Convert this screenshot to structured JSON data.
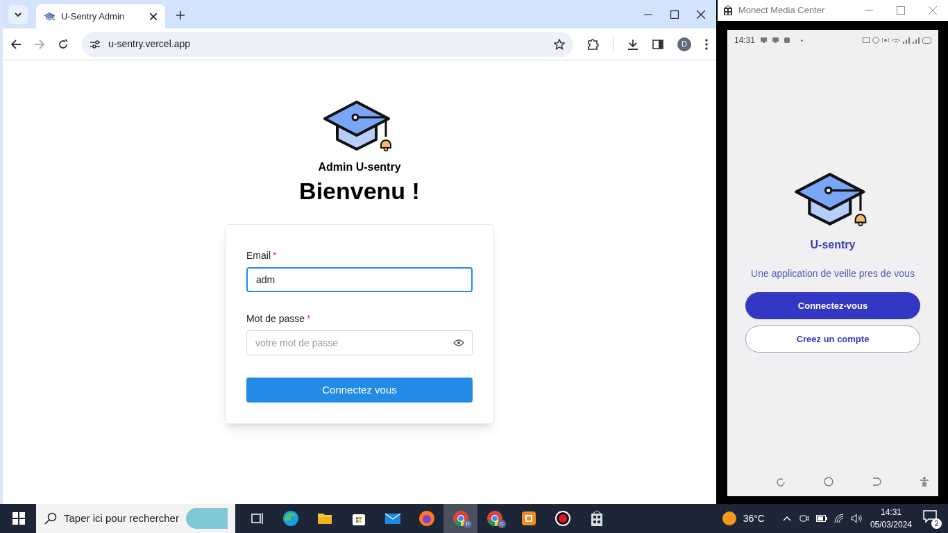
{
  "browser": {
    "tab": {
      "title": "U-Sentry Admin",
      "selected": true
    },
    "url": "u-sentry.vercel.app",
    "profile": "D",
    "page": {
      "app_name": "Admin U-sentry",
      "heading": "Bienvenu !",
      "fields": [
        {
          "label": "Email",
          "required_mark": "*",
          "value": "adm",
          "focused": true
        },
        {
          "label": "Mot de passe",
          "required_mark": "*",
          "placeholder": "votre mot de passe",
          "focused": false
        }
      ],
      "submit": "Connectez vous"
    }
  },
  "phone_window": {
    "title": "Monect Media Center",
    "status_time": "14:31",
    "app_name": "U-sentry",
    "tagline": "Une application de veille pres de vous",
    "buttons": [
      {
        "label": "Connectez-vous",
        "kind": "primary"
      },
      {
        "label": "Creez un compte",
        "kind": "outline"
      }
    ]
  },
  "taskbar": {
    "search_placeholder": "Taper ici pour rechercher",
    "apps": [
      {
        "kind": "taskview",
        "selected": false
      },
      {
        "kind": "edge",
        "selected": false
      },
      {
        "kind": "folder",
        "selected": false
      },
      {
        "kind": "store",
        "selected": false
      },
      {
        "kind": "mail",
        "selected": false
      },
      {
        "kind": "firefox",
        "selected": false
      },
      {
        "kind": "chrome",
        "badge": "D",
        "selected": true
      },
      {
        "kind": "chrome",
        "badge": "C",
        "selected": false
      },
      {
        "kind": "slides",
        "selected": false
      },
      {
        "kind": "record",
        "selected": false
      },
      {
        "kind": "monect",
        "selected": false
      }
    ],
    "weather": "36°C",
    "time": "14:31",
    "date": "05/03/2024",
    "notifications": "2"
  }
}
